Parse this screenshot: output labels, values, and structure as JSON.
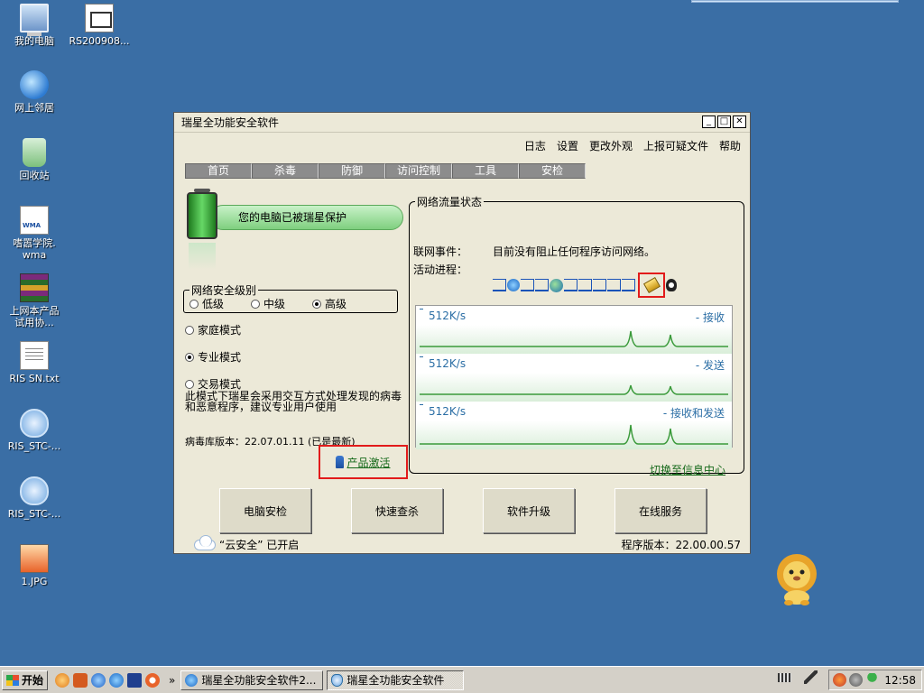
{
  "desktop": {
    "icons": [
      {
        "label": "我的电脑"
      },
      {
        "label": "RS200908..."
      },
      {
        "label": "网上邻居"
      },
      {
        "label": "回收站"
      },
      {
        "label": "嗜嚣学院.\nwma"
      },
      {
        "label": "上网本产品\n试用协..."
      },
      {
        "label": "RIS SN.txt"
      },
      {
        "label": "RIS_STC-..."
      },
      {
        "label": "RIS_STC-..."
      },
      {
        "label": "1.JPG"
      }
    ]
  },
  "window": {
    "title": "瑞星全功能安全软件",
    "controls": {
      "minimize": "_",
      "maximize": "□",
      "close": "✕"
    },
    "menu": [
      "日志",
      "设置",
      "更改外观",
      "上报可疑文件",
      "帮助"
    ],
    "tabs": [
      "首页",
      "杀毒",
      "防御",
      "访问控制",
      "工具",
      "安检"
    ],
    "protection_status": "您的电脑已被瑞星保护",
    "security_level": {
      "legend": "网络安全级别",
      "options": [
        "低级",
        "中级",
        "高级"
      ],
      "selected": "高级"
    },
    "modes": {
      "options": [
        "家庭模式",
        "专业模式",
        "交易模式"
      ],
      "selected": "专业模式"
    },
    "mode_description": "此模式下瑞星会采用交互方式处理发现的病毒和恶意程序，建议专业用户使用",
    "virus_db_version": "病毒库版本：22.07.01.11 (已是最新)",
    "activate_link": "产品激活",
    "network": {
      "legend": "网络流量状态",
      "event_label": "联网事件：",
      "event_value": "目前没有阻止任何程序访问网络。",
      "process_label": "活动进程：",
      "graphs": [
        {
          "rate": "512K/s",
          "legend": "- 接收"
        },
        {
          "rate": "512K/s",
          "legend": "- 发送"
        },
        {
          "rate": "512K/s",
          "legend": "- 接收和发送"
        }
      ],
      "switch_link": "切换至信息中心"
    },
    "buttons": [
      "电脑安检",
      "快速查杀",
      "软件升级",
      "在线服务"
    ],
    "cloud_status": "“云安全” 已开启",
    "program_version": "程序版本：22.00.00.57"
  },
  "taskbar": {
    "start_label": "开始",
    "more_chevron": "»",
    "tasks": [
      {
        "label": "瑞星全功能安全软件2..."
      },
      {
        "label": "瑞星全功能安全软件"
      }
    ],
    "clock": "12:58"
  }
}
